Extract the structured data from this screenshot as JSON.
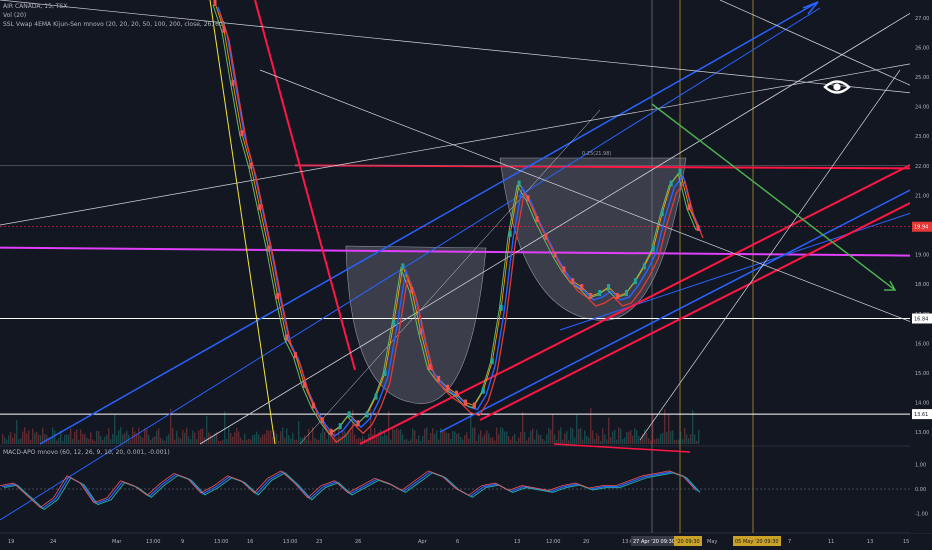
{
  "header": {
    "title": "AIR CANADA, 15, TSX",
    "volume_legend": "Vol (20)",
    "indicator_legend": "SSL Vwap 4EMA Kijun-Sen mnovo (20, 20, 20, 50, 100, 200, close, 26, 60)",
    "macd_legend": "MACD-APO mnovo (60, 12, 26, 9, 10, 20, 0.001, -0.001)"
  },
  "overlay": {
    "fib_label": "0.25(21.98)",
    "eye_icon": "eye-icon"
  },
  "price_axis": {
    "ticks": [
      "27.00",
      "26.00",
      "25.00",
      "24.00",
      "23.00",
      "22.00",
      "21.00",
      "20.00",
      "19.00",
      "18.00",
      "17.00",
      "16.00",
      "15.00",
      "14.00",
      "13.00"
    ],
    "badges": [
      {
        "text": "19.94",
        "color": "#e53935"
      },
      {
        "text": "16.84",
        "color": "#ffffff"
      },
      {
        "text": "13.61",
        "color": "#ffffff"
      }
    ]
  },
  "macd_axis": {
    "ticks": [
      "1.00",
      "0.00",
      "-1.00"
    ]
  },
  "time_axis": {
    "ticks": [
      "19",
      "24",
      "Mar",
      "13:00",
      "9",
      "13:00",
      "16",
      "13:00",
      "23",
      "26",
      "Apr",
      "6",
      "13",
      "12:00",
      "20",
      "13:00"
    ],
    "highlighted": [
      "27 Apr '20  09:30",
      "'20  09:30",
      "05 May '20  09:30"
    ],
    "after": [
      "May",
      "7",
      "11",
      "13",
      "15"
    ]
  },
  "colors": {
    "background": "#131722",
    "up": "#26a69a",
    "down": "#ef5350",
    "trend_red": "#ff1744",
    "channel_blue": "#2962ff",
    "magenta": "#e040fb",
    "green_arrow": "#4caf50",
    "yellow": "#f5e43a"
  },
  "chart_data": {
    "type": "line",
    "title": "AIR CANADA, 15, TSX",
    "ylim": [
      12.6,
      27.6
    ],
    "macd_ylim": [
      -1.6,
      1.6
    ],
    "series": [
      {
        "name": "",
        "y": [
          27.5,
          26.6,
          24.8,
          23.1,
          22.0,
          20.6,
          19.2,
          17.6,
          16.2,
          15.6,
          14.6,
          13.9,
          13.4,
          13.0,
          13.2,
          13.6,
          13.3,
          13.6,
          14.2,
          15.0,
          16.7,
          18.6,
          17.8,
          16.4,
          15.2,
          14.8,
          14.5,
          14.3,
          14.0,
          13.9,
          14.4,
          15.4,
          17.2,
          19.7,
          21.4,
          20.9,
          20.2,
          19.6,
          19.0,
          18.5,
          18.1,
          17.9,
          17.6,
          17.7,
          17.9,
          17.6,
          17.7,
          18.1,
          18.6,
          19.2,
          20.4,
          21.4,
          21.8,
          20.6,
          19.9
        ]
      }
    ],
    "macd": [
      0.1,
      0.2,
      -0.3,
      -0.8,
      -0.4,
      0.5,
      0.2,
      -0.6,
      -0.4,
      0.3,
      0.1,
      -0.3,
      0.2,
      0.6,
      0.4,
      -0.2,
      0.1,
      0.5,
      0.3,
      -0.2,
      0.4,
      0.7,
      0.2,
      -0.4,
      0.1,
      0.3,
      -0.2,
      0.1,
      0.4,
      0.2,
      -0.1,
      0.3,
      0.7,
      0.5,
      0.0,
      -0.3,
      0.1,
      0.2,
      -0.1,
      0.1,
      0.0,
      -0.1,
      0.1,
      0.2,
      0.0,
      0.1,
      0.1,
      0.3,
      0.5,
      0.6,
      0.7,
      0.5,
      -0.1
    ],
    "levels": {
      "resistance": 21.98,
      "magenta": 19.1,
      "current": 19.94,
      "white_upper": 16.84,
      "white_lower": 13.61
    },
    "grid": false
  }
}
